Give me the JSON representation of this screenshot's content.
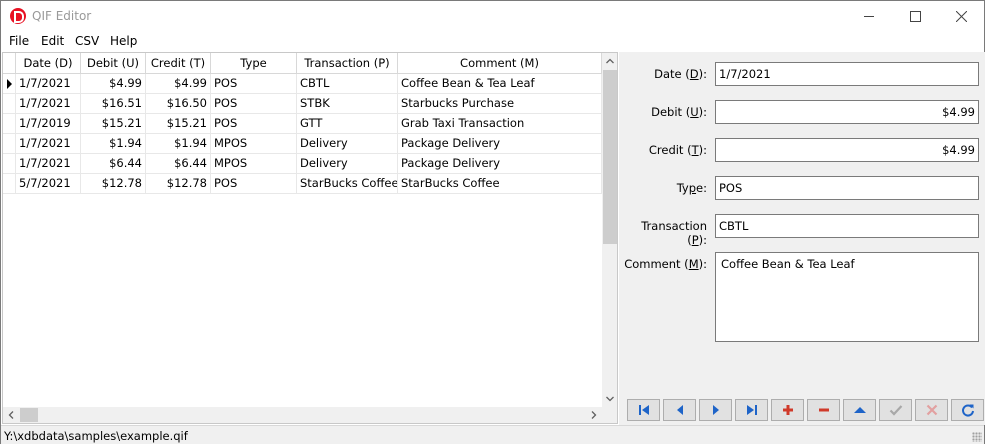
{
  "window": {
    "title": "QIF Editor",
    "icon": "app-logo-icon"
  },
  "menu": [
    "File",
    "Edit",
    "CSV",
    "Help"
  ],
  "grid": {
    "columns": [
      "Date (D)",
      "Debit (U)",
      "Credit (T)",
      "Type",
      "Transaction (P)",
      "Comment (M)"
    ],
    "rows": [
      [
        "1/7/2021",
        "$4.99",
        "$4.99",
        "POS",
        "CBTL",
        "Coffee Bean & Tea Leaf"
      ],
      [
        "1/7/2021",
        "$16.51",
        "$16.50",
        "POS",
        "STBK",
        "Starbucks Purchase"
      ],
      [
        "1/7/2019",
        "$15.21",
        "$15.21",
        "POS",
        "GTT",
        "Grab Taxi Transaction"
      ],
      [
        "1/7/2021",
        "$1.94",
        "$1.94",
        "MPOS",
        "Delivery",
        "Package Delivery"
      ],
      [
        "1/7/2021",
        "$6.44",
        "$6.44",
        "MPOS",
        "Delivery",
        "Package Delivery"
      ],
      [
        "5/7/2021",
        "$12.78",
        "$12.78",
        "POS",
        "StarBucks Coffee",
        "StarBucks Coffee"
      ]
    ],
    "current_row": 0
  },
  "editor": {
    "date": {
      "label_pre": "Date (",
      "label_key": "D",
      "label_post": "):",
      "value": "1/7/2021"
    },
    "debit": {
      "label_pre": "Debit (",
      "label_key": "U",
      "label_post": "):",
      "value": "$4.99"
    },
    "credit": {
      "label_pre": "Credit (",
      "label_key": "T",
      "label_post": "):",
      "value": "$4.99"
    },
    "type": {
      "label_pre": "Ty",
      "label_key": "p",
      "label_post": "e:",
      "value": "POS"
    },
    "transaction": {
      "label_pre": "Transaction (",
      "label_key": "P",
      "label_post": "):",
      "value": "CBTL"
    },
    "comment": {
      "label_pre": "Comment (",
      "label_key": "M",
      "label_post": "):",
      "value": "Coffee Bean & Tea Leaf"
    }
  },
  "navigator": [
    {
      "name": "first-record-button",
      "icon": "skip-first-icon",
      "color": "#1e64c8",
      "enabled": true
    },
    {
      "name": "prior-record-button",
      "icon": "previous-icon",
      "color": "#1e64c8",
      "enabled": true
    },
    {
      "name": "next-record-button",
      "icon": "next-icon",
      "color": "#1e64c8",
      "enabled": true
    },
    {
      "name": "last-record-button",
      "icon": "skip-last-icon",
      "color": "#1e64c8",
      "enabled": true
    },
    {
      "name": "insert-record-button",
      "icon": "plus-icon",
      "color": "#d03a2a",
      "enabled": true
    },
    {
      "name": "delete-record-button",
      "icon": "minus-icon",
      "color": "#d03a2a",
      "enabled": true
    },
    {
      "name": "edit-record-button",
      "icon": "triangle-up-icon",
      "color": "#1e64c8",
      "enabled": true
    },
    {
      "name": "post-record-button",
      "icon": "check-icon",
      "color": "#a8a8a8",
      "enabled": false
    },
    {
      "name": "cancel-edit-button",
      "icon": "x-icon",
      "color": "#e2a0a0",
      "enabled": false
    },
    {
      "name": "refresh-button",
      "icon": "refresh-icon",
      "color": "#1e64c8",
      "enabled": true
    }
  ],
  "status": {
    "path": "Y:\\xdbdata\\samples\\example.qif"
  }
}
